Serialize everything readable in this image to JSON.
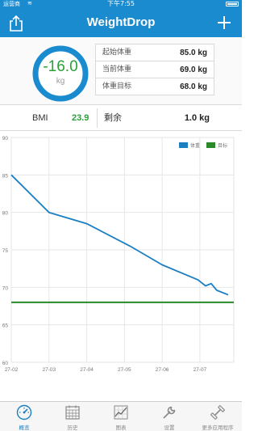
{
  "status_bar": {
    "carrier": "运营商",
    "time": "下午7:55"
  },
  "nav": {
    "title": "WeightDrop",
    "share_icon": "share-icon",
    "add_icon": "plus-icon"
  },
  "summary": {
    "delta_value": "-16.0",
    "delta_unit": "kg",
    "ring_color": "#1b8bd0",
    "delta_color": "#2aa13a",
    "stats": [
      {
        "label": "起始体重",
        "value": "85.0 kg"
      },
      {
        "label": "当前体重",
        "value": "69.0 kg"
      },
      {
        "label": "体重目标",
        "value": "68.0 kg"
      }
    ],
    "bmi_label": "BMI",
    "bmi_value": "23.9",
    "remain_label": "剩余",
    "remain_value": "1.0 kg"
  },
  "chart_data": {
    "type": "line",
    "ylim": [
      60,
      90
    ],
    "y_ticks": [
      60,
      65,
      70,
      75,
      80,
      85,
      90
    ],
    "x_tick_labels": [
      "27-02",
      "27-03",
      "27-04",
      "27-05",
      "27-06",
      "27-07"
    ],
    "grid": true,
    "legend_position": "top-right",
    "series": [
      {
        "name": "体重",
        "color": "#1b7fc2",
        "points": [
          {
            "x": 0,
            "y": 85
          },
          {
            "x": 1,
            "y": 80
          },
          {
            "x": 2,
            "y": 78.5
          },
          {
            "x": 3.15,
            "y": 75.5
          },
          {
            "x": 4,
            "y": 73
          },
          {
            "x": 4.95,
            "y": 71
          },
          {
            "x": 5.15,
            "y": 70.2
          },
          {
            "x": 5.3,
            "y": 70.5
          },
          {
            "x": 5.45,
            "y": 69.6
          },
          {
            "x": 5.75,
            "y": 69
          }
        ]
      },
      {
        "name": "目标",
        "color": "#2a8a2a",
        "constant": 68
      }
    ]
  },
  "tabs": [
    {
      "label": "概览",
      "icon": "gauge-icon",
      "active": true
    },
    {
      "label": "历史",
      "icon": "calendar-icon",
      "active": false
    },
    {
      "label": "图表",
      "icon": "line-chart-icon",
      "active": false
    },
    {
      "label": "设置",
      "icon": "wrench-icon",
      "active": false
    },
    {
      "label": "更多应用程序",
      "icon": "dumbbell-icon",
      "active": false
    }
  ]
}
